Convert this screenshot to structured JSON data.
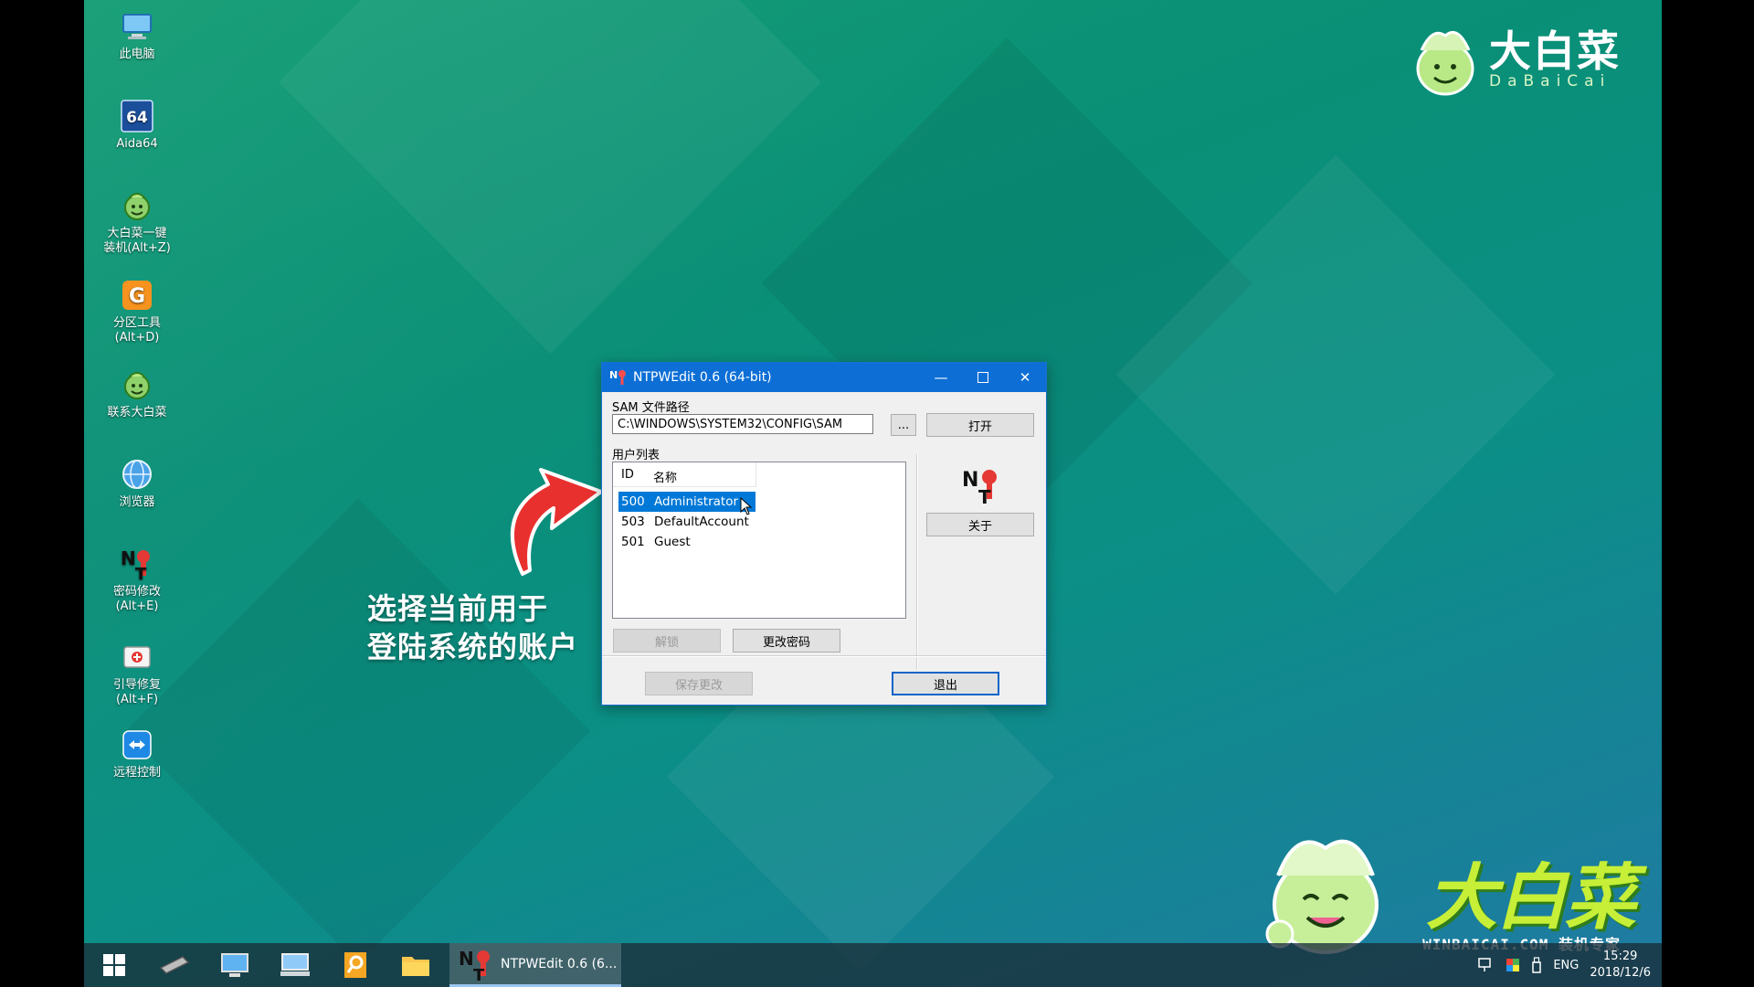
{
  "desktop": {
    "icons": [
      {
        "label": "此电脑",
        "icon": "computer-icon"
      },
      {
        "label": "Aida64",
        "icon": "aida64-icon"
      },
      {
        "label": "大白菜一键\n装机(Alt+Z)",
        "icon": "dabaicai-install-icon"
      },
      {
        "label": "分区工具\n(Alt+D)",
        "icon": "partition-tool-icon"
      },
      {
        "label": "联系大白菜",
        "icon": "dabaicai-contact-icon"
      },
      {
        "label": "浏览器",
        "icon": "browser-icon"
      },
      {
        "label": "密码修改\n(Alt+E)",
        "icon": "password-change-icon"
      },
      {
        "label": "引导修复\n(Alt+F)",
        "icon": "boot-repair-icon"
      },
      {
        "label": "远程控制",
        "icon": "remote-control-icon"
      }
    ]
  },
  "brand": {
    "top_cn": "大白菜",
    "top_en": "DaBaiCai",
    "bottom_cn": "大白菜",
    "bottom_url": "WINBAICAI.COM 装机专家"
  },
  "annotation": {
    "line1": "选择当前用于",
    "line2": "登陆系统的账户",
    "arrow_color": "#e8312f"
  },
  "window": {
    "title": "NTPWEdit 0.6 (64-bit)",
    "sam_label": "SAM 文件路径",
    "sam_path": "C:\\WINDOWS\\SYSTEM32\\CONFIG\\SAM",
    "browse_label": "...",
    "open_label": "打开",
    "users_label": "用户列表",
    "columns": {
      "id": "ID",
      "name": "名称"
    },
    "users": [
      {
        "id": "500",
        "name": "Administrator",
        "selected": true
      },
      {
        "id": "503",
        "name": "DefaultAccount",
        "selected": false
      },
      {
        "id": "501",
        "name": "Guest",
        "selected": false
      }
    ],
    "about_label": "关于",
    "unlock_label": "解锁",
    "change_password_label": "更改密码",
    "save_label": "保存更改",
    "exit_label": "退出",
    "accent": "#0d6fd6"
  },
  "taskbar": {
    "items": [
      "start-icon",
      "drive-icon",
      "remote-desktop-icon",
      "network-icon",
      "search-tool-icon",
      "file-explorer-icon"
    ],
    "active_app": "NTPWEdit 0.6 (6...",
    "tray": {
      "lang": "ENG",
      "time": "15:29",
      "date": "2018/12/6"
    }
  }
}
